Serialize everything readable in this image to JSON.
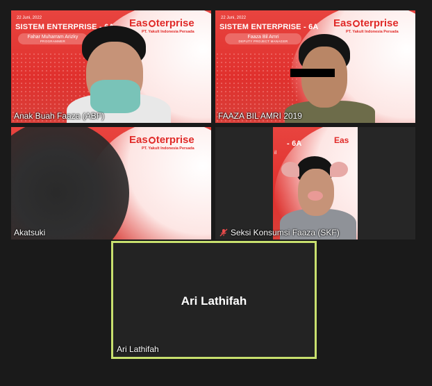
{
  "participants": [
    {
      "name": "Anak Buah Faaza (ABF)"
    },
    {
      "name": "FAAZA BIL AMRI 2019"
    },
    {
      "name": "Akatsuki"
    },
    {
      "name": "Seksi Konsumsi Faaza (SKF)"
    },
    {
      "name": "Ari Lathifah"
    }
  ],
  "active_speaker": {
    "display": "Ari Lathifah",
    "label": "Ari Lathifah"
  },
  "slides": {
    "date": "22 Juni, 2022",
    "event": "SISTEM ENTERPRISE - 6A",
    "brand_left": "Eas",
    "brand_right": "terprise",
    "brand_sub": "PT. Yakult Indonesia Persada",
    "presenter1": {
      "name": "Fahar Muharram Arizky",
      "role": "PROGRAMMER"
    },
    "presenter2": {
      "name": "Faaza Bil Amri",
      "role": "DEPUTY PROJECT MANAGER"
    },
    "partial_title": "- 6A",
    "partial_label": "il"
  },
  "colors": {
    "slide_red": "#e0302d",
    "active_border": "#c8e06e",
    "background": "#1a1a1a"
  }
}
